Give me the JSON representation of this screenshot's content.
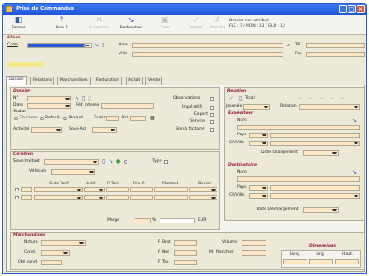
{
  "window": {
    "title": "Prise de Commandes"
  },
  "toolbar": {
    "buttons": [
      {
        "label": "Fermer",
        "icon": "◧"
      },
      {
        "label": "Aide ?",
        "icon": "?"
      },
      {
        "label": "Supprimer",
        "icon": "✕"
      },
      {
        "label": "Rechercher",
        "icon": "↘"
      },
      {
        "label": "Créer",
        "icon": "▣"
      },
      {
        "label": "Valider",
        "icon": "✓"
      },
      {
        "label": "Annuler",
        "icon": "✗"
      }
    ],
    "info1": "Dossier non attribué",
    "info2": "FLE : 7 / MON : 13 / GLD : 1 /"
  },
  "client": {
    "section": "Client",
    "code_label": "Code",
    "nom_label": "Nom",
    "ville_label": "Ville",
    "tel_label": "Tél",
    "fax_label": "Fax"
  },
  "tabs": [
    "Dossier",
    "Relations",
    "Marchandises",
    "Facturation",
    "Achat",
    "Vente"
  ],
  "dossier": {
    "section": "Dossier",
    "n_label": "N°",
    "date_label": "Date",
    "ref_label": "Réf. interne",
    "statut_label": "Statut",
    "statut_options": [
      "En cours",
      "Refusé",
      "Bloqué"
    ],
    "gratis_label": "Gratis",
    "km_label": "Km",
    "activite_label": "Activité",
    "sousact_label": "Sous-Act",
    "observations_label": "Observations",
    "imperatifs_label": "Impératifs",
    "export_label": "Export",
    "service_label": "Service",
    "bon_label": "Bon à facturer"
  },
  "cotation": {
    "section": "Cotation",
    "soustraitant_label": "Sous-traitant",
    "type_label": "Type",
    "vehicule_label": "Véhicule",
    "grid_headers": [
      "Code Tarif",
      "Unité",
      "P. Tarif",
      "Prix U.",
      "Montant",
      "Devise"
    ],
    "marge_label": "Marge",
    "pct": "%",
    "eur": "EUR"
  },
  "relation": {
    "section": "Relation",
    "total_label": "Total",
    "journee_label": "Journée",
    "relation_label": "Relation"
  },
  "expediteur": {
    "section": "Expéditeur",
    "nom_label": "Nom",
    "pays_label": "Pays",
    "cpville_label": "CP/Ville",
    "date_label": "Date Chargement"
  },
  "destinataire": {
    "section": "Destinataire",
    "nom_label": "Nom",
    "pays_label": "Pays",
    "cpville_label": "CP/Ville",
    "date_label": "Date Déchargement"
  },
  "marchandises": {
    "section": "Marchandises",
    "nature_label": "Nature",
    "cond_label": "Cond.",
    "qte_label": "Qté cond.",
    "pbrut_label": "P. Brut",
    "pnet_label": "P. Net",
    "ptax_label": "P. Tax",
    "volume_label": "Volume",
    "plancher_label": "M. Plancher",
    "dim_title": "Dimensions",
    "dim_cols": [
      "Long.",
      "larg.",
      "Haut."
    ]
  }
}
